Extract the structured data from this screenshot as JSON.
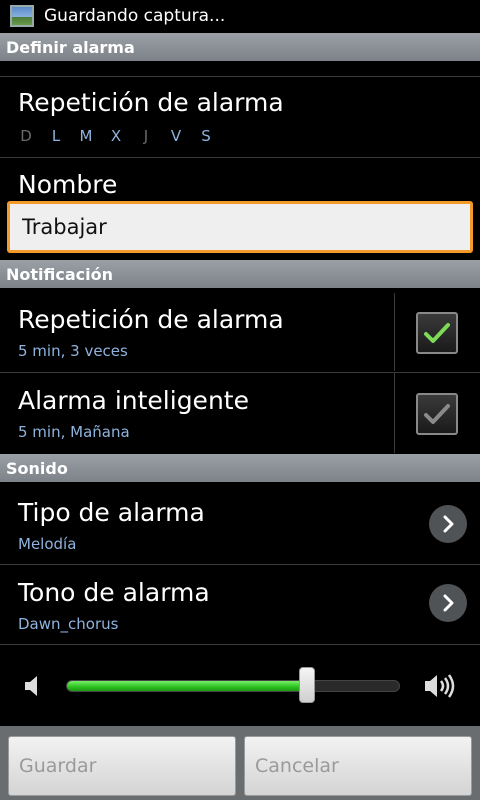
{
  "status_bar": {
    "text": "Guardando captura..."
  },
  "sections": {
    "define": "Definir alarma",
    "notification": "Notificación",
    "sound": "Sonido"
  },
  "repeat": {
    "title": "Repetición de alarma",
    "days": [
      {
        "label": "D",
        "active": false
      },
      {
        "label": "L",
        "active": true
      },
      {
        "label": "M",
        "active": true
      },
      {
        "label": "X",
        "active": true
      },
      {
        "label": "J",
        "active": false
      },
      {
        "label": "V",
        "active": true
      },
      {
        "label": "S",
        "active": true
      }
    ]
  },
  "name": {
    "title": "Nombre",
    "value": "Trabajar"
  },
  "snooze": {
    "title": "Repetición de alarma",
    "subtitle": "5 min, 3 veces",
    "checked": true
  },
  "smart": {
    "title": "Alarma inteligente",
    "subtitle": "5 min, Mañana",
    "checked": false
  },
  "alarm_type": {
    "title": "Tipo de alarma",
    "subtitle": "Melodía"
  },
  "alarm_tone": {
    "title": "Tono de alarma",
    "subtitle": "Dawn_chorus"
  },
  "volume": {
    "level": 0.72
  },
  "buttons": {
    "save": "Guardar",
    "cancel": "Cancelar"
  },
  "colors": {
    "accent_blue": "#8fb3de",
    "check_green": "#7ed957",
    "focus_orange": "#f29a2a",
    "slider_green": "#2bbf1f"
  }
}
